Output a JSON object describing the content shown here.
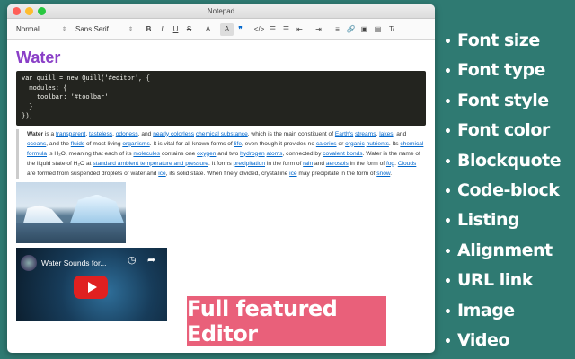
{
  "window": {
    "title": "Notepad"
  },
  "toolbar": {
    "header_picker": "Normal",
    "font_picker": "Sans Serif",
    "arrows": "⇕",
    "buttons": [
      {
        "name": "bold-button",
        "glyph": "B"
      },
      {
        "name": "italic-button",
        "glyph": "I"
      },
      {
        "name": "underline-button",
        "glyph": "U"
      },
      {
        "name": "strike-button",
        "glyph": "S"
      },
      {
        "name": "font-color-button",
        "glyph": "A"
      },
      {
        "name": "background-color-button",
        "glyph": "A"
      },
      {
        "name": "blockquote-button",
        "glyph": "❞"
      },
      {
        "name": "code-block-button",
        "glyph": "</>"
      },
      {
        "name": "ordered-list-button",
        "glyph": "☰"
      },
      {
        "name": "bullet-list-button",
        "glyph": "☰"
      },
      {
        "name": "indent-decrease-button",
        "glyph": "⇤"
      },
      {
        "name": "indent-increase-button",
        "glyph": "⇥"
      },
      {
        "name": "align-button",
        "glyph": "≡"
      },
      {
        "name": "link-button",
        "glyph": "🔗"
      },
      {
        "name": "image-button",
        "glyph": "▣"
      },
      {
        "name": "video-button",
        "glyph": "▤"
      },
      {
        "name": "clean-button",
        "glyph": "T̸"
      }
    ]
  },
  "editor": {
    "heading": "Water",
    "code": "var quill = new Quill('#editor', {\n  modules: {\n    toolbar: '#toolbar'\n  }\n});",
    "quote": {
      "parts": [
        {
          "t": "Water",
          "b": true
        },
        {
          "t": " is a "
        },
        {
          "t": "transparent",
          "a": true
        },
        {
          "t": ", "
        },
        {
          "t": "tasteless",
          "a": true
        },
        {
          "t": ", "
        },
        {
          "t": "odorless",
          "a": true
        },
        {
          "t": ", and "
        },
        {
          "t": "nearly colorless",
          "a": true
        },
        {
          "t": " "
        },
        {
          "t": "chemical substance",
          "a": true
        },
        {
          "t": ", which is the main constituent of "
        },
        {
          "t": "Earth's",
          "a": true
        },
        {
          "t": " "
        },
        {
          "t": "streams",
          "a": true
        },
        {
          "t": ", "
        },
        {
          "t": "lakes",
          "a": true
        },
        {
          "t": ", and "
        },
        {
          "t": "oceans",
          "a": true
        },
        {
          "t": ", and the "
        },
        {
          "t": "fluids",
          "a": true
        },
        {
          "t": " of most living "
        },
        {
          "t": "organisms",
          "a": true
        },
        {
          "t": ". It is vital for all known forms of "
        },
        {
          "t": "life",
          "a": true
        },
        {
          "t": ", even though it provides no "
        },
        {
          "t": "calories",
          "a": true
        },
        {
          "t": " or "
        },
        {
          "t": "organic",
          "a": true
        },
        {
          "t": " "
        },
        {
          "t": "nutrients",
          "a": true
        },
        {
          "t": ". Its "
        },
        {
          "t": "chemical formula",
          "a": true
        },
        {
          "t": " is H₂O, meaning that each of its "
        },
        {
          "t": "molecules",
          "a": true
        },
        {
          "t": " contains one "
        },
        {
          "t": "oxygen",
          "a": true
        },
        {
          "t": " and two "
        },
        {
          "t": "hydrogen",
          "a": true
        },
        {
          "t": " "
        },
        {
          "t": "atoms",
          "a": true
        },
        {
          "t": ", connected by "
        },
        {
          "t": "covalent bonds",
          "a": true
        },
        {
          "t": ". Water is the name of the liquid state of H₂O at "
        },
        {
          "t": "standard ambient temperature and pressure",
          "a": true
        },
        {
          "t": ". It forms "
        },
        {
          "t": "precipitation",
          "a": true
        },
        {
          "t": " in the form of "
        },
        {
          "t": "rain",
          "a": true
        },
        {
          "t": " and "
        },
        {
          "t": "aerosols",
          "a": true
        },
        {
          "t": " in the form of "
        },
        {
          "t": "fog",
          "a": true
        },
        {
          "t": ". "
        },
        {
          "t": "Clouds",
          "a": true
        },
        {
          "t": " are formed from suspended droplets of water and "
        },
        {
          "t": "ice",
          "a": true
        },
        {
          "t": ", its solid state. When finely divided, crystalline "
        },
        {
          "t": "ice",
          "a": true
        },
        {
          "t": " may precipitate in the form of "
        },
        {
          "t": "snow",
          "a": true
        },
        {
          "t": "."
        }
      ]
    },
    "video": {
      "title": "Water Sounds for..."
    }
  },
  "banner": "Full featured Editor",
  "features": [
    "Font size",
    "Font type",
    "Font style",
    "Font color",
    "Blockquote",
    "Code-block",
    "Listing",
    "Alignment",
    "URL link",
    "Image",
    "Video"
  ],
  "bullet": "•",
  "colors": {
    "background": "#2f7a72",
    "heading": "#8a3fc7",
    "banner": "#e9607a",
    "link": "#0066cc",
    "code_bg": "#23241f"
  }
}
